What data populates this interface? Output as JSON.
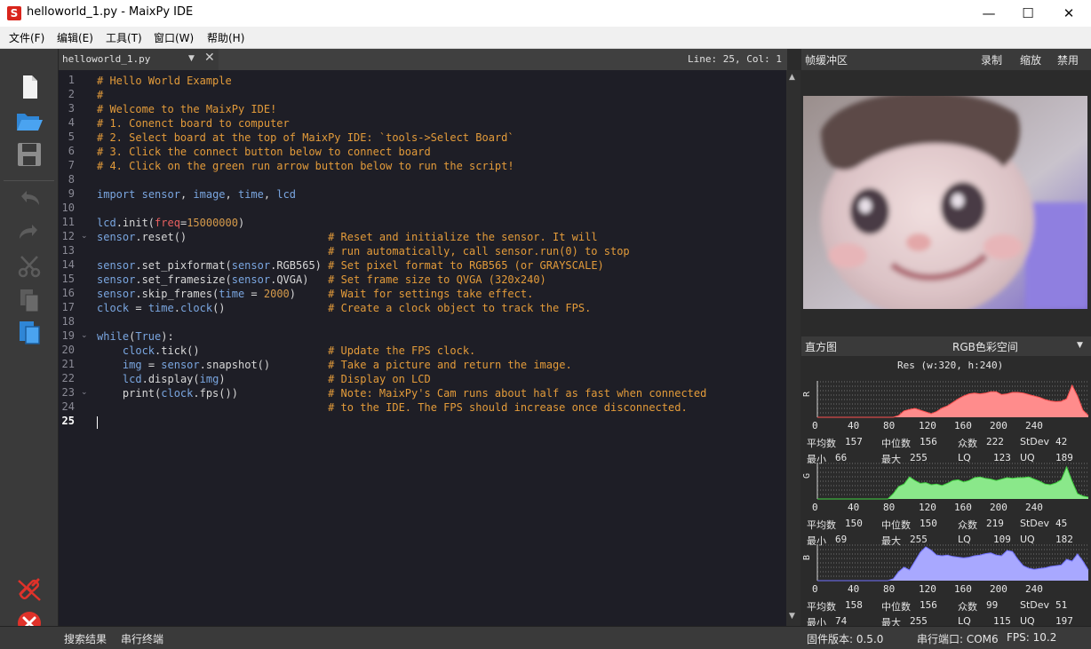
{
  "window": {
    "icon_letter": "S",
    "title": "helloworld_1.py - MaixPy IDE",
    "minimize": "—",
    "maximize": "☐",
    "close": "✕"
  },
  "menu": [
    "文件(F)",
    "编辑(E)",
    "工具(T)",
    "窗口(W)",
    "帮助(H)"
  ],
  "toolbar": {
    "icons": [
      "new-file-icon",
      "open-folder-icon",
      "save-icon",
      "undo-icon",
      "redo-icon",
      "cut-icon",
      "copy-icon",
      "paste-icon",
      "disconnect-icon",
      "stop-icon"
    ]
  },
  "editor": {
    "tab_name": "helloworld_1.py",
    "cursor": "Line: 25, Col: 1",
    "active_line": 25,
    "lines": [
      "# Hello World Example",
      "#",
      "# Welcome to the MaixPy IDE!",
      "# 1. Conenct board to computer",
      "# 2. Select board at the top of MaixPy IDE: `tools->Select Board`",
      "# 3. Click the connect button below to connect board",
      "# 4. Click on the green run arrow button below to run the script!",
      "",
      "import sensor, image, time, lcd",
      "",
      "lcd.init(freq=15000000)",
      "sensor.reset()                      # Reset and initialize the sensor. It will",
      "                                    # run automatically, call sensor.run(0) to stop",
      "sensor.set_pixformat(sensor.RGB565) # Set pixel format to RGB565 (or GRAYSCALE)",
      "sensor.set_framesize(sensor.QVGA)   # Set frame size to QVGA (320x240)",
      "sensor.skip_frames(time = 2000)     # Wait for settings take effect.",
      "clock = time.clock()                # Create a clock object to track the FPS.",
      "",
      "while(True):",
      "    clock.tick()                    # Update the FPS clock.",
      "    img = sensor.snapshot()         # Take a picture and return the image.",
      "    lcd.display(img)                # Display on LCD",
      "    print(clock.fps())              # Note: MaixPy's Cam runs about half as fast when connected",
      "                                    # to the IDE. The FPS should increase once disconnected.",
      ""
    ],
    "fold_lines": [
      12,
      19,
      23
    ]
  },
  "framebuffer": {
    "title": "帧缓冲区",
    "record": "录制",
    "zoom": "缩放",
    "disable": "禁用"
  },
  "histogram": {
    "title": "直方图",
    "colorspace": "RGB色彩空间",
    "resolution": "Res (w:320, h:240)",
    "axis_ticks": [
      "0",
      "40",
      "80",
      "120",
      "160",
      "200",
      "240"
    ],
    "channels": [
      {
        "name": "R",
        "color": "#ff8c8c",
        "line": "#ff5050",
        "mean_label": "平均数",
        "mean": "157",
        "median_label": "中位数",
        "median": "156",
        "mode_label": "众数",
        "mode": "222",
        "stdev_label": "StDev",
        "stdev": "42",
        "min_label": "最小",
        "min": "66",
        "max_label": "最大",
        "max": "255",
        "lq_label": "LQ",
        "lq": "123",
        "uq_label": "UQ",
        "uq": "189",
        "shape": [
          0,
          0,
          0,
          0,
          0,
          0,
          0,
          0,
          0,
          0,
          0,
          0,
          0,
          0,
          0,
          0.05,
          0.18,
          0.22,
          0.25,
          0.2,
          0.15,
          0.1,
          0.16,
          0.26,
          0.32,
          0.42,
          0.52,
          0.6,
          0.66,
          0.68,
          0.66,
          0.68,
          0.72,
          0.72,
          0.64,
          0.66,
          0.7,
          0.7,
          0.68,
          0.64,
          0.6,
          0.56,
          0.5,
          0.46,
          0.44,
          0.45,
          0.52,
          0.9,
          0.6,
          0.2,
          0.05
        ]
      },
      {
        "name": "G",
        "color": "#8ae88a",
        "line": "#40d040",
        "mean_label": "平均数",
        "mean": "150",
        "median_label": "中位数",
        "median": "150",
        "mode_label": "众数",
        "mode": "219",
        "stdev_label": "StDev",
        "stdev": "45",
        "min_label": "最小",
        "min": "69",
        "max_label": "最大",
        "max": "255",
        "lq_label": "LQ",
        "lq": "109",
        "uq_label": "UQ",
        "uq": "182",
        "shape": [
          0,
          0,
          0,
          0,
          0,
          0,
          0,
          0,
          0,
          0,
          0,
          0,
          0,
          0,
          0.15,
          0.35,
          0.42,
          0.62,
          0.52,
          0.44,
          0.46,
          0.4,
          0.42,
          0.38,
          0.44,
          0.52,
          0.54,
          0.48,
          0.52,
          0.6,
          0.62,
          0.58,
          0.56,
          0.52,
          0.56,
          0.6,
          0.58,
          0.6,
          0.6,
          0.62,
          0.56,
          0.5,
          0.42,
          0.4,
          0.45,
          0.54,
          0.9,
          0.5,
          0.15,
          0.08,
          0.05
        ]
      },
      {
        "name": "B",
        "color": "#a8a8ff",
        "line": "#7070ff",
        "mean_label": "平均数",
        "mean": "158",
        "median_label": "中位数",
        "median": "156",
        "mode_label": "众数",
        "mode": "99",
        "stdev_label": "StDev",
        "stdev": "51",
        "min_label": "最小",
        "min": "74",
        "max_label": "最大",
        "max": "255",
        "lq_label": "LQ",
        "lq": "115",
        "uq_label": "UQ",
        "uq": "197",
        "shape": [
          0,
          0,
          0,
          0,
          0,
          0,
          0,
          0,
          0,
          0,
          0,
          0,
          0,
          0,
          0.05,
          0.25,
          0.38,
          0.3,
          0.55,
          0.8,
          0.95,
          0.86,
          0.72,
          0.7,
          0.72,
          0.68,
          0.66,
          0.64,
          0.66,
          0.7,
          0.72,
          0.76,
          0.78,
          0.72,
          0.7,
          0.85,
          0.82,
          0.6,
          0.42,
          0.35,
          0.32,
          0.34,
          0.36,
          0.4,
          0.42,
          0.44,
          0.6,
          0.55,
          0.75,
          0.55,
          0.3
        ]
      }
    ]
  },
  "status": {
    "search_results": "搜索结果",
    "serial_terminal": "串行终端",
    "firmware": "固件版本: 0.5.0",
    "serial_port": "串行端口: COM6",
    "fps": "FPS: 10.2"
  },
  "colors": {
    "editor_bg": "#1e1e26",
    "comment": "#e39b3a",
    "keyword": "#7aa6e0",
    "accent_blue": "#3b8fe0",
    "danger_red": "#e0322a"
  }
}
